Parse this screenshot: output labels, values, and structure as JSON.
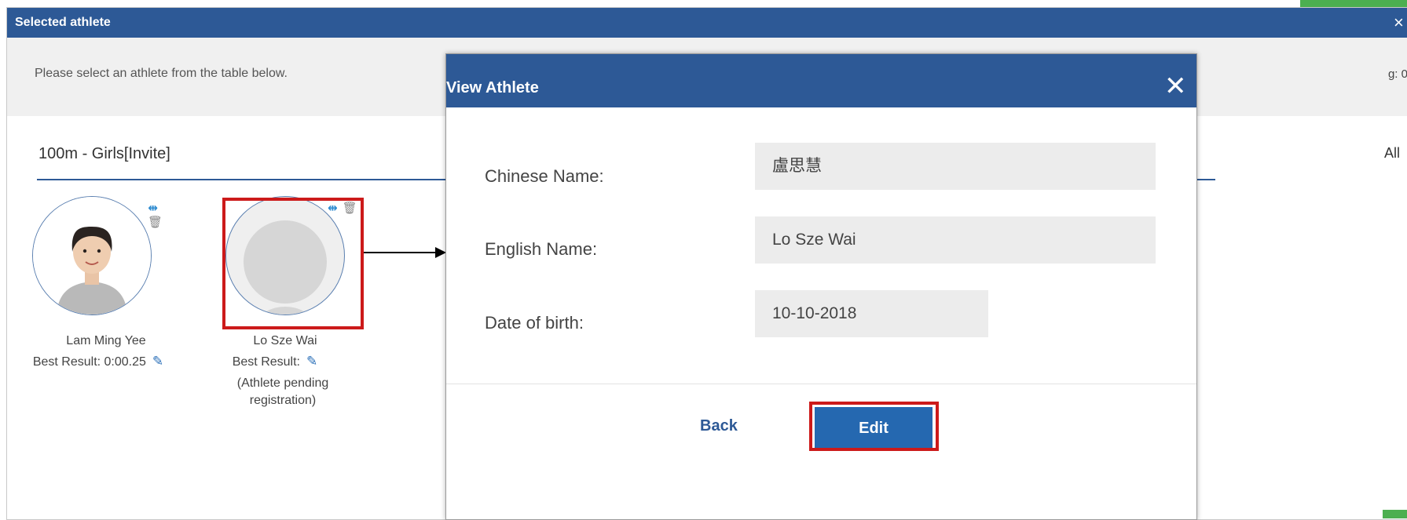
{
  "background_dialog": {
    "title": "Selected athlete",
    "close_icon": "×",
    "instruction": "Please select an athlete from the table below.",
    "count_fragment": "g: 0",
    "event_title": "100m - Girls[Invite]",
    "all_fragment": "All"
  },
  "athletes": [
    {
      "name": "Lam Ming Yee",
      "best_result": "Best Result: 0:00.25",
      "note": ""
    },
    {
      "name": "Lo Sze Wai",
      "best_result": "Best Result:",
      "note_line1": "(Athlete pending",
      "note_line2": "registration)"
    }
  ],
  "icons": {
    "link": "⇹",
    "trash": "🗑",
    "pencil": "✎"
  },
  "view_modal": {
    "title": "View Athlete",
    "close_icon": "✕",
    "fields": {
      "chinese_name": {
        "label": "Chinese Name:",
        "value": "盧思慧"
      },
      "english_name": {
        "label": "English Name:",
        "value": "Lo Sze Wai"
      },
      "dob": {
        "label": "Date of birth:",
        "value": "10-10-2018"
      }
    },
    "back_label": "Back",
    "edit_label": "Edit"
  },
  "colors": {
    "header_blue": "#2d5996",
    "edit_button": "#2568b0",
    "highlight_red": "#cc1a1a"
  }
}
